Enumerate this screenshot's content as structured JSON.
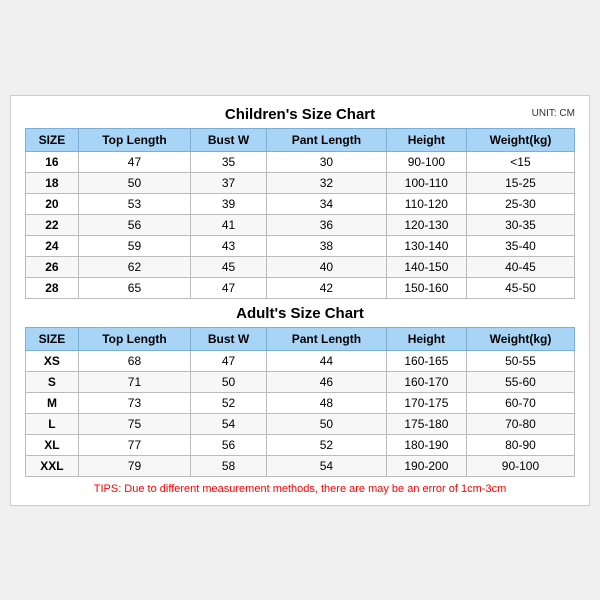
{
  "children_section": {
    "title": "Children's Size Chart",
    "unit": "UNIT: CM",
    "headers": [
      "SIZE",
      "Top Length",
      "Bust W",
      "Pant Length",
      "Height",
      "Weight(kg)"
    ],
    "rows": [
      [
        "16",
        "47",
        "35",
        "30",
        "90-100",
        "<15"
      ],
      [
        "18",
        "50",
        "37",
        "32",
        "100-110",
        "15-25"
      ],
      [
        "20",
        "53",
        "39",
        "34",
        "110-120",
        "25-30"
      ],
      [
        "22",
        "56",
        "41",
        "36",
        "120-130",
        "30-35"
      ],
      [
        "24",
        "59",
        "43",
        "38",
        "130-140",
        "35-40"
      ],
      [
        "26",
        "62",
        "45",
        "40",
        "140-150",
        "40-45"
      ],
      [
        "28",
        "65",
        "47",
        "42",
        "150-160",
        "45-50"
      ]
    ]
  },
  "adult_section": {
    "title": "Adult's Size Chart",
    "headers": [
      "SIZE",
      "Top Length",
      "Bust W",
      "Pant Length",
      "Height",
      "Weight(kg)"
    ],
    "rows": [
      [
        "XS",
        "68",
        "47",
        "44",
        "160-165",
        "50-55"
      ],
      [
        "S",
        "71",
        "50",
        "46",
        "160-170",
        "55-60"
      ],
      [
        "M",
        "73",
        "52",
        "48",
        "170-175",
        "60-70"
      ],
      [
        "L",
        "75",
        "54",
        "50",
        "175-180",
        "70-80"
      ],
      [
        "XL",
        "77",
        "56",
        "52",
        "180-190",
        "80-90"
      ],
      [
        "XXL",
        "79",
        "58",
        "54",
        "190-200",
        "90-100"
      ]
    ]
  },
  "tips": "TIPS: Due to different measurement methods, there are may be an error of 1cm-3cm"
}
